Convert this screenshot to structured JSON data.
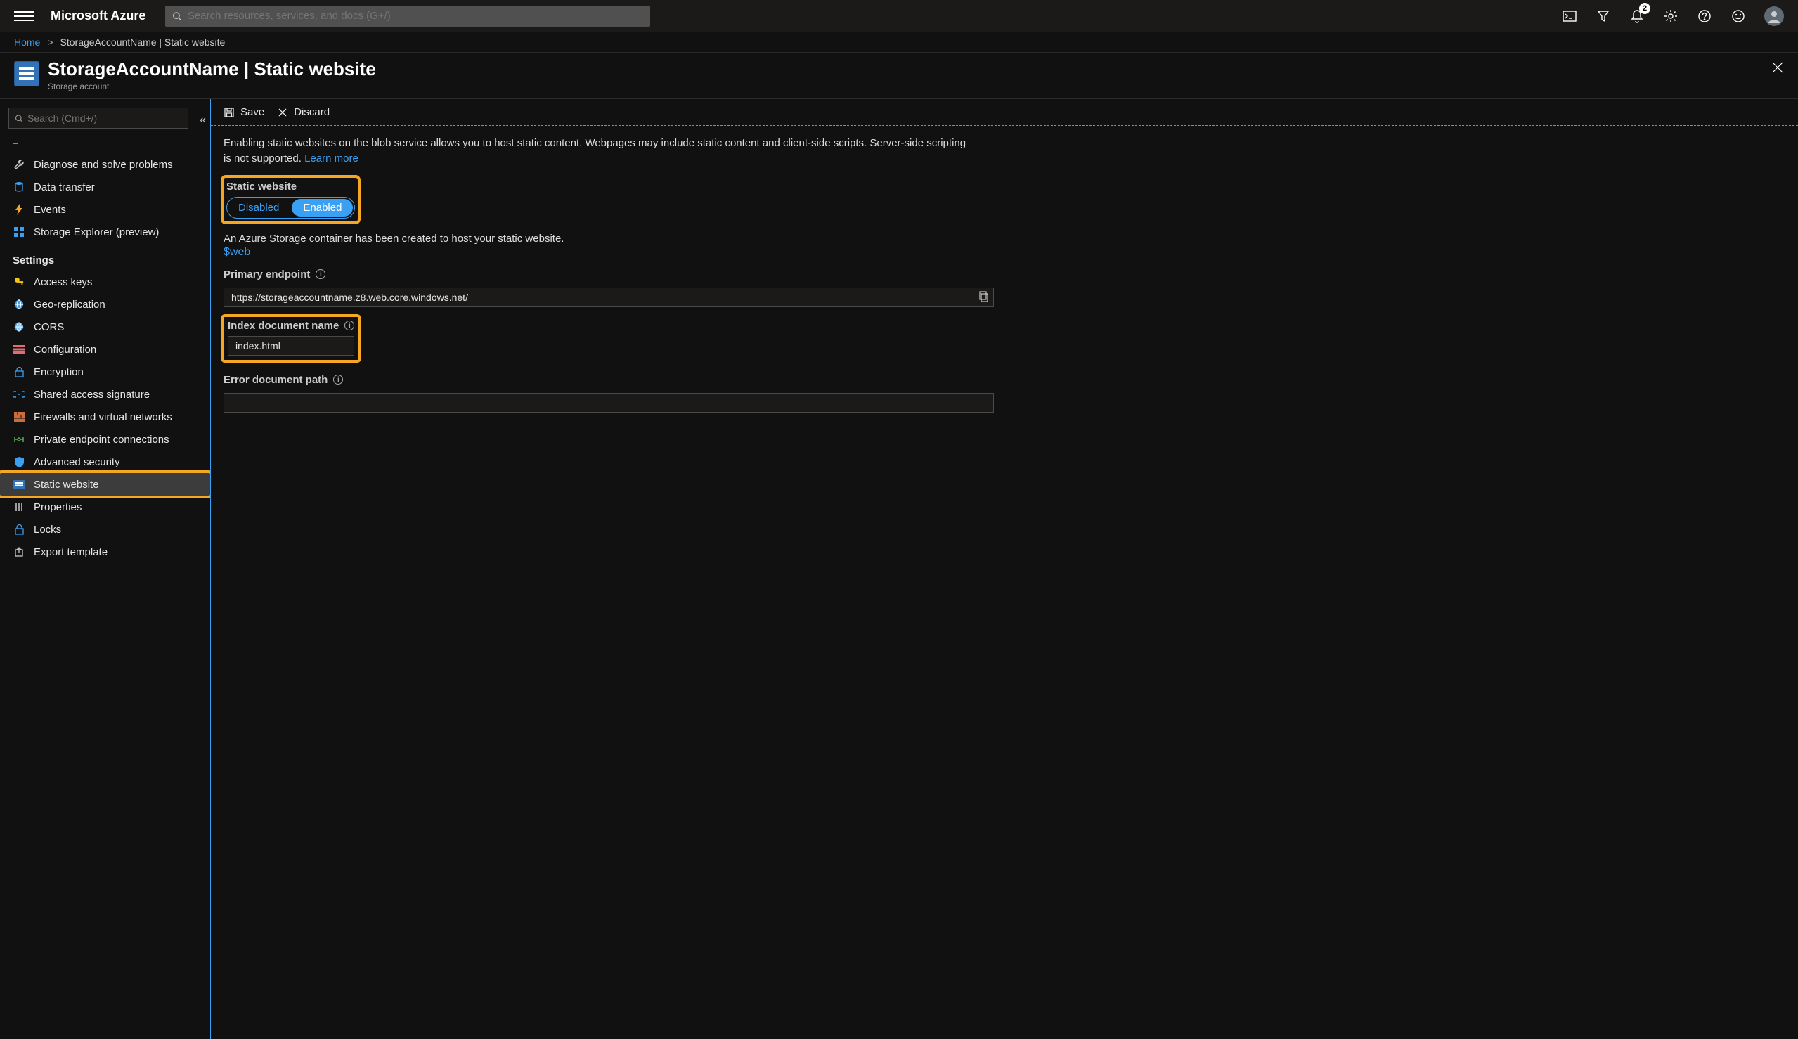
{
  "topbar": {
    "brand": "Microsoft Azure",
    "search_placeholder": "Search resources, services, and docs (G+/)",
    "notification_count": "2"
  },
  "breadcrumb": {
    "home": "Home",
    "current": "StorageAccountName | Static website"
  },
  "header": {
    "title": "StorageAccountName | Static website",
    "subtitle": "Storage account"
  },
  "sidebar": {
    "search_placeholder": "Search (Cmd+/)",
    "items_top": [
      {
        "label": "Diagnose and solve problems",
        "icon": "wrench"
      },
      {
        "label": "Data transfer",
        "icon": "db"
      },
      {
        "label": "Events",
        "icon": "bolt"
      },
      {
        "label": "Storage Explorer (preview)",
        "icon": "grid"
      }
    ],
    "settings_title": "Settings",
    "items_settings": [
      {
        "label": "Access keys",
        "icon": "key"
      },
      {
        "label": "Geo-replication",
        "icon": "globe"
      },
      {
        "label": "CORS",
        "icon": "cors"
      },
      {
        "label": "Configuration",
        "icon": "config"
      },
      {
        "label": "Encryption",
        "icon": "lock"
      },
      {
        "label": "Shared access signature",
        "icon": "linkicon"
      },
      {
        "label": "Firewalls and virtual networks",
        "icon": "firewall"
      },
      {
        "label": "Private endpoint connections",
        "icon": "endpoint"
      },
      {
        "label": "Advanced security",
        "icon": "shield"
      },
      {
        "label": "Static website",
        "icon": "staticweb"
      },
      {
        "label": "Properties",
        "icon": "props"
      },
      {
        "label": "Locks",
        "icon": "lock2"
      },
      {
        "label": "Export template",
        "icon": "export"
      }
    ],
    "active_index": 9
  },
  "toolbar": {
    "save_label": "Save",
    "discard_label": "Discard"
  },
  "main": {
    "intro": "Enabling static websites on the blob service allows you to host static content. Webpages may include static content and client-side scripts. Server-side scripting is not supported.",
    "learn_more": "Learn more",
    "toggle_label": "Static website",
    "toggle_disabled": "Disabled",
    "toggle_enabled": "Enabled",
    "container_msg": "An Azure Storage container has been created to host your static website.",
    "container_link": "$web",
    "primary_label": "Primary endpoint",
    "primary_value": "https://storageaccountname.z8.web.core.windows.net/",
    "index_label": "Index document name",
    "index_value": "index.html",
    "error_label": "Error document path",
    "error_value": ""
  }
}
